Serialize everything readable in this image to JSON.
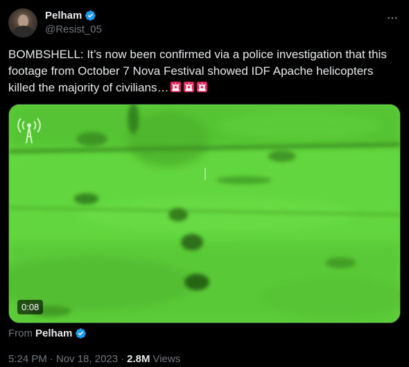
{
  "author": {
    "name": "Pelham",
    "handle": "@Resist_05",
    "avatar_icon": "avatar-photo",
    "verified_icon": "verified-badge-icon",
    "verified_color": "#1d9bf0"
  },
  "menu": {
    "icon": "more-options-icon"
  },
  "tweet": {
    "text": "BOMBSHELL: It’s now been confirmed via a police investigation that this footage from October 7 Nova Festival showed IDF Apache helicopters killed the majority of civilians…",
    "emoji_icon": "police-siren-icon",
    "emoji_count": 3
  },
  "media": {
    "duration": "0:08",
    "overlay_icon": "broadcast-antenna-icon",
    "tint_color": "#5fd33c"
  },
  "source": {
    "label": "From",
    "name": "Pelham"
  },
  "meta": {
    "time": "5:24 PM",
    "date": "Nov 18, 2023",
    "separator": "·",
    "views_count": "2.8M",
    "views_label": "Views"
  },
  "colors": {
    "background": "#000000",
    "text_primary": "#e7e9ea",
    "text_secondary": "#71767b"
  }
}
